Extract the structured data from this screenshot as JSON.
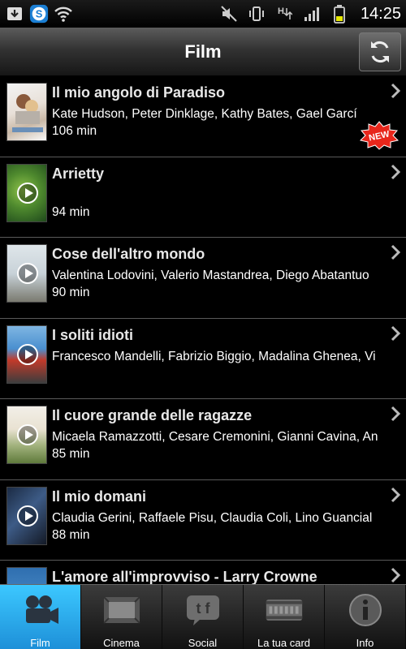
{
  "status_bar": {
    "time": "14:25"
  },
  "header": {
    "title": "Film"
  },
  "films": [
    {
      "title": "Il mio angolo di Paradiso",
      "cast": "Kate Hudson, Peter Dinklage, Kathy Bates, Gael Garcí",
      "duration": "106 min",
      "badge": "NEW",
      "has_trailer": false
    },
    {
      "title": "Arrietty",
      "cast": "",
      "duration": "94 min",
      "has_trailer": true
    },
    {
      "title": "Cose dell'altro mondo",
      "cast": "Valentina Lodovini, Valerio Mastandrea, Diego Abatantuo",
      "duration": "90 min",
      "has_trailer": true
    },
    {
      "title": "I soliti idioti",
      "cast": "Francesco Mandelli, Fabrizio Biggio, Madalina Ghenea, Vi",
      "duration": "",
      "has_trailer": true
    },
    {
      "title": "Il cuore grande delle ragazze",
      "cast": "Micaela Ramazzotti, Cesare Cremonini, Gianni Cavina, An",
      "duration": "85 min",
      "has_trailer": true
    },
    {
      "title": "Il mio domani",
      "cast": "Claudia Gerini, Raffaele Pisu, Claudia Coli, Lino Guancial",
      "duration": "88 min",
      "has_trailer": true
    },
    {
      "title": "L'amore all'improvviso - Larry Crowne",
      "cast": "",
      "duration": "",
      "has_trailer": false
    }
  ],
  "tabs": [
    {
      "label": "Film",
      "icon": "film-camera-icon",
      "active": true
    },
    {
      "label": "Cinema",
      "icon": "cinema-screen-icon"
    },
    {
      "label": "Social",
      "icon": "social-icon"
    },
    {
      "label": "La tua card",
      "icon": "card-icon"
    },
    {
      "label": "Info",
      "icon": "info-icon"
    }
  ],
  "colors": {
    "accent": "#2aa7ee",
    "badge_red": "#e8261b",
    "background": "#000000"
  }
}
